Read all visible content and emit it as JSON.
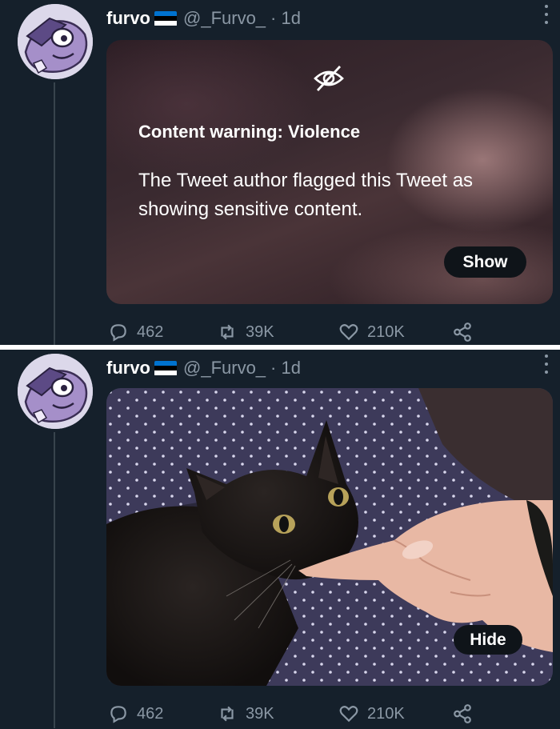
{
  "colors": {
    "background": "#15202b",
    "secondary_text": "#8b98a5",
    "pill_bg": "#0f1419",
    "flag": [
      "#0072ce",
      "#000000",
      "#ffffff"
    ]
  },
  "tweets": [
    {
      "author": {
        "name": "furvo",
        "handle": "@_Furvo_",
        "time": "· 1d",
        "flag_icon": "estonia-flag-icon"
      },
      "content_warning": {
        "icon": "eye-slash-icon",
        "title": "Content warning: Violence",
        "body": "The Tweet author flagged this Tweet as showing sensitive content."
      },
      "media_button": "Show",
      "stats": {
        "replies": "462",
        "retweets": "39K",
        "likes": "210K"
      }
    },
    {
      "author": {
        "name": "furvo",
        "handle": "@_Furvo_",
        "time": "· 1d",
        "flag_icon": "estonia-flag-icon"
      },
      "media_button": "Hide",
      "stats": {
        "replies": "462",
        "retweets": "39K",
        "likes": "210K"
      }
    }
  ]
}
